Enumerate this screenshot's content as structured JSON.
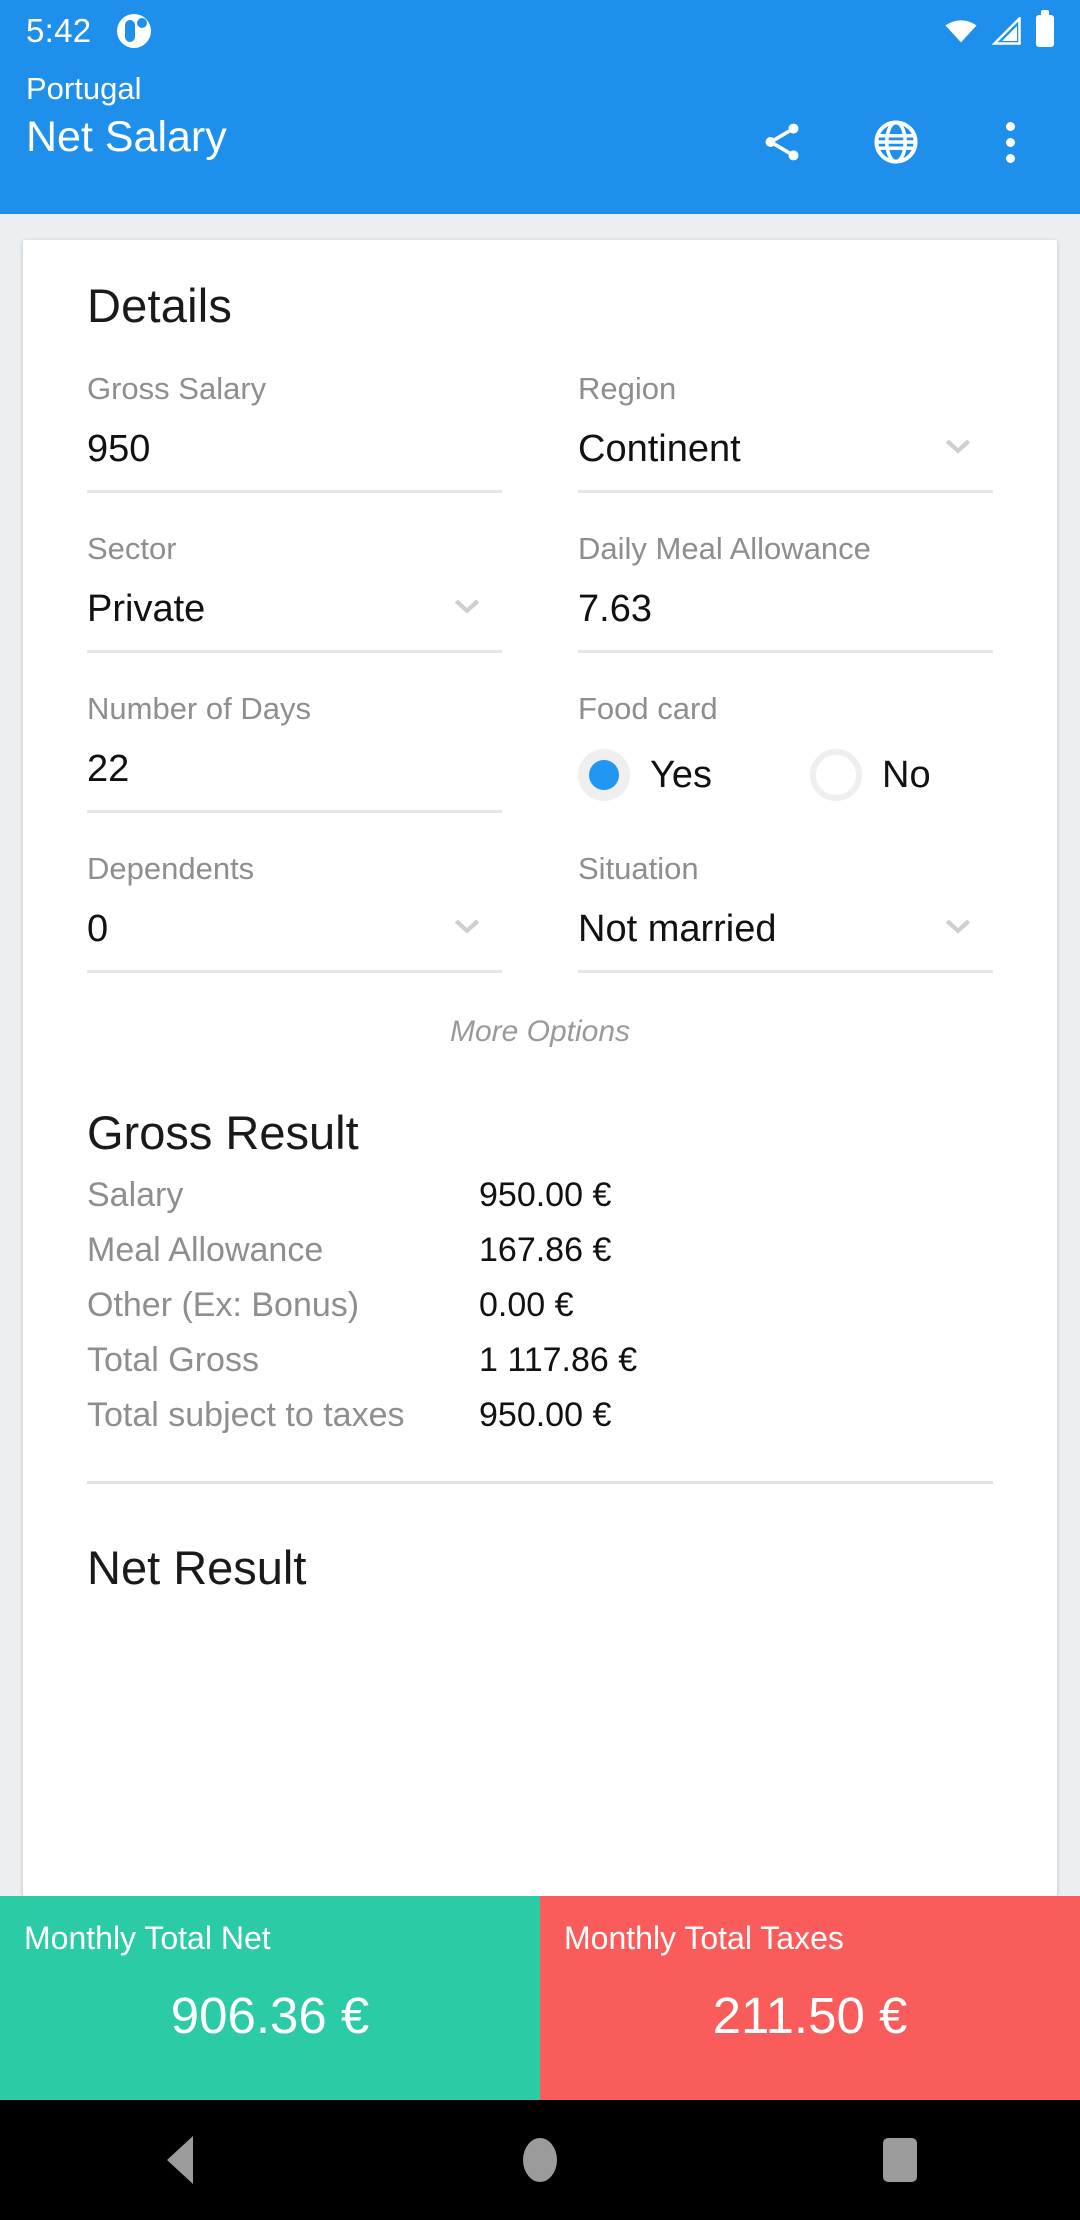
{
  "statusbar": {
    "time": "5:42",
    "icons": [
      "notification-icon",
      "wifi-icon",
      "signal-icon",
      "battery-icon"
    ]
  },
  "appbar": {
    "subtitle": "Portugal",
    "title": "Net Salary",
    "actions": [
      "share-icon",
      "globe-icon",
      "overflow-menu-icon"
    ],
    "background": "#1f8fec"
  },
  "details": {
    "heading": "Details",
    "gross_salary": {
      "label": "Gross Salary",
      "value": "950"
    },
    "region": {
      "label": "Region",
      "value": "Continent"
    },
    "sector": {
      "label": "Sector",
      "value": "Private"
    },
    "daily_meal_allowance": {
      "label": "Daily Meal Allowance",
      "value": "7.63"
    },
    "number_of_days": {
      "label": "Number of Days",
      "value": "22"
    },
    "food_card": {
      "label": "Food card",
      "yes_label": "Yes",
      "no_label": "No",
      "selected": "Yes"
    },
    "dependents": {
      "label": "Dependents",
      "value": "0"
    },
    "situation": {
      "label": "Situation",
      "value": "Not married"
    },
    "more_options": "More Options"
  },
  "gross_result": {
    "heading": "Gross Result",
    "rows": [
      {
        "label": "Salary",
        "value": "950.00 €"
      },
      {
        "label": "Meal Allowance",
        "value": "167.86 €"
      },
      {
        "label": "Other (Ex: Bonus)",
        "value": "0.00 €"
      },
      {
        "label": "Total Gross",
        "value": "1 117.86 €"
      },
      {
        "label": "Total subject to taxes",
        "value": "950.00 €"
      }
    ]
  },
  "net_result": {
    "heading": "Net Result"
  },
  "totals": {
    "net": {
      "caption": "Monthly Total Net",
      "value": "906.36 €",
      "color": "#2bcca5"
    },
    "taxes": {
      "caption": "Monthly Total Taxes",
      "value": "211.50 €",
      "color": "#fa5c5c"
    }
  },
  "navbar": {
    "buttons": [
      "back-button",
      "home-button",
      "recents-button"
    ]
  }
}
